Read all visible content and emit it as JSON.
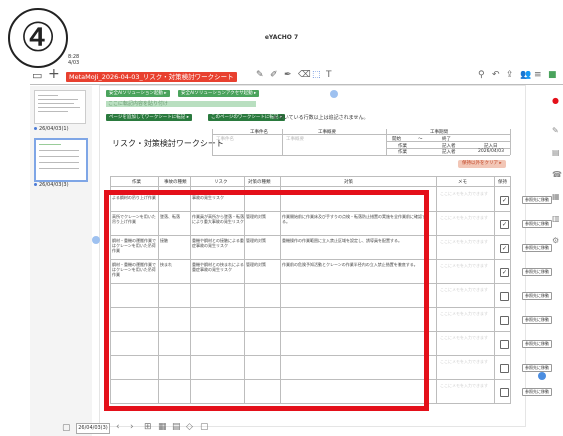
{
  "step_badge": "④",
  "app_title": "eYACHO 7",
  "file_name": "MetaMoJi_2026-04-03_リスク・対策検討ワークシート",
  "status_small": [
    "8:28",
    "4/03"
  ],
  "sidebar": {
    "pages": [
      {
        "label": "26/04/03(1)"
      },
      {
        "label": "26/04/03(3)"
      }
    ]
  },
  "page_buttons": {
    "template1": "安全AIソリューション起動 ▸",
    "template2": "安全AIソリューションアクセサ起動 ▸",
    "add_page": "ページを追加してワークシートに転記 ▸",
    "transfer": "このページのワークシートに転記 ▸",
    "note": "※ 空いている行数以上は追記されません。",
    "input_hint": "ここに転記内容を貼り付け"
  },
  "worksheet": {
    "title": "リスク・対策検討ワークシート",
    "header": {
      "work_name": "工事件名",
      "work_summary": "工事概要",
      "work_name_ph": "工事件名",
      "work_summary_ph": "工事概要",
      "period": "工事期間",
      "start": "開始",
      "tilde": "〜",
      "end": "終了",
      "role": "作業",
      "writer": "記入者",
      "date_label": "記入日",
      "leader": "作業",
      "leader2": "記入者",
      "date": "2026/04/03"
    },
    "clear_button": "保持以外をクリア ▸",
    "columns": [
      "作業",
      "事故の種類",
      "リスク",
      "対策の種類",
      "対策",
      "メモ",
      "保持"
    ],
    "memo_placeholder": "ここにメモを入力できます",
    "rows": [
      {
        "work": "高所でのクレーン作業による鋼材の吊り上げ作業",
        "type": "落下",
        "risk": "作業中の鋼材落下による重大事故の発生リスク",
        "measure_type": "管理的対策",
        "measure": "作業前の吊り具の点検と作業範囲の立入禁止措置",
        "checked": true
      },
      {
        "work": "高所でクレーンを用いた吊り上げ作業",
        "type": "墜落、転落",
        "risk": "作業員が高所から墜落・転落により重大事故の発生リスク",
        "measure_type": "管理的対策",
        "measure": "作業開始前に作業床及び手すりの点検・転落防止措置の実施を全作業前に確認する。",
        "checked": true
      },
      {
        "work": "鋼材・重機の運搬作業ではクレーンを用いた吊荷作業",
        "type": "接触",
        "risk": "重機や鋼材との接触による重症事故の発生リスク",
        "measure_type": "管理的対策",
        "measure": "重機操作の作業範囲に立入禁止区域を設定し、誘導員を配置する。",
        "checked": true
      },
      {
        "work": "鋼材・重機の運搬作業ではクレーンを用いた吊荷作業",
        "type": "挟まれ",
        "risk": "重機や鋼材との挟まれによる重症事故の発生リスク",
        "measure_type": "管理的対策",
        "measure": "作業前の危険予知活動とクレーンの作業半径内の立入禁止措置を徹底する。",
        "checked": true
      },
      {
        "work": "",
        "type": "",
        "risk": "",
        "measure_type": "",
        "measure": "",
        "checked": false
      },
      {
        "work": "",
        "type": "",
        "risk": "",
        "measure_type": "",
        "measure": "",
        "checked": false
      },
      {
        "work": "",
        "type": "",
        "risk": "",
        "measure_type": "",
        "measure": "",
        "checked": false
      },
      {
        "work": "",
        "type": "",
        "risk": "",
        "measure_type": "",
        "measure": "",
        "checked": false
      },
      {
        "work": "",
        "type": "",
        "risk": "",
        "measure_type": "",
        "measure": "",
        "checked": false
      }
    ],
    "move_button": "参照先に移動"
  },
  "bottom": {
    "page_field": "26/04/03(3)"
  },
  "colors": {
    "highlight": "#e4101a",
    "file_tab": "#e8402f",
    "green_button": "#4aa35c",
    "clear_button": "#f2c6b6"
  }
}
